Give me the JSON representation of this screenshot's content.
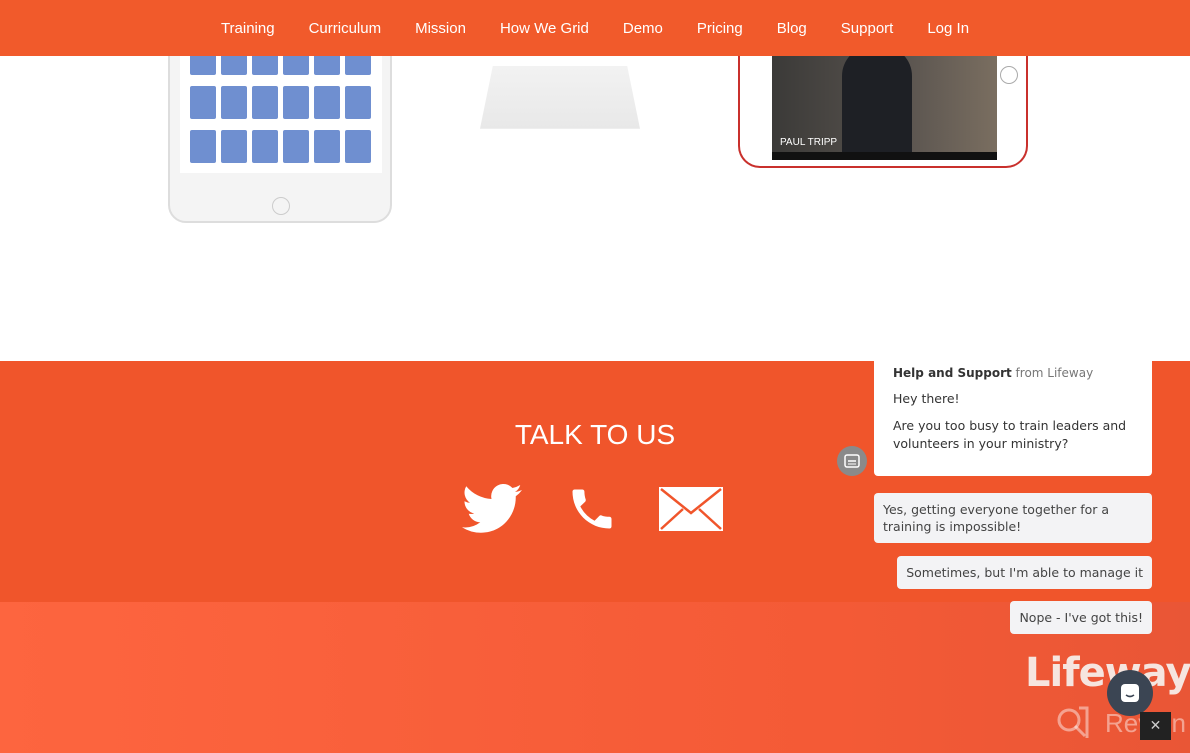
{
  "nav": {
    "items": [
      "Training",
      "Curriculum",
      "Mission",
      "How We Grid",
      "Demo",
      "Pricing",
      "Blog",
      "Support",
      "Log In"
    ]
  },
  "devices": {
    "video_caption": "PAUL TRIPP"
  },
  "talk": {
    "title": "TALK TO US",
    "icons": [
      "twitter-icon",
      "phone-icon",
      "mail-icon"
    ]
  },
  "footer": {
    "logo": "Lifeway"
  },
  "chat": {
    "header_bold": "Help and Support",
    "header_rest": " from Lifeway",
    "messages": [
      "Hey there!",
      "Are you too busy to train leaders and volunteers in your ministry?"
    ],
    "replies": [
      "Yes, getting everyone together for a training is impossible!",
      "Sometimes, but I'm able to manage it",
      "Nope - I've got this!"
    ]
  },
  "watermark": "Revain",
  "colors": {
    "brand": "#f15a2b",
    "footer": "#fd653f",
    "launcher": "#3b4553"
  }
}
